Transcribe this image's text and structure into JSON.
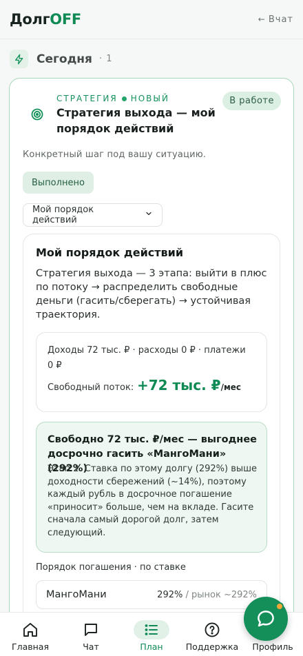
{
  "header": {
    "logo_part1": "Долг",
    "logo_part2": "OFF",
    "back_label": "Вчат",
    "back_arrow": "←"
  },
  "section": {
    "title": "Сегодня",
    "count": "· 1",
    "icon": "lightning-icon"
  },
  "task_card": {
    "kicker": "СТРАТЕГИЯ",
    "kicker_badge": "НОВЫЙ",
    "title": "Стратегия выхода — мой порядок действий",
    "status": "В работе",
    "description": "Конкретный шаг под вашу ситуацию.",
    "done_button": "Выполнено",
    "dropdown_label": "Мой порядок действий",
    "icon": "target-icon"
  },
  "plan": {
    "title": "Мой порядок действий",
    "lead": "Стратегия выхода — 3 этапа: выйти в плюс по потоку → распределить свободные деньги (гасить/сберегать) → устойчивая траектория.",
    "flow_summary": "Доходы 72 тыс. ₽ · расходы 0 ₽ · платежи 0 ₽",
    "free_flow_label": "Свободный поток:",
    "free_flow_value": "+72 тыс. ₽",
    "free_flow_unit": "/мес",
    "advice_title": "Свободно 72 тыс. ₽/мес — выгоднее досрочно гасить «МангоМани» (292%)",
    "advice_text": "Этап 2. Ставка по этому долгу (292%) выше доходности сбережений (~14%), поэтому каждый рубль в досрочное погашение «приносит» больше, чем на вкладе. Гасите сначала самый дорогой долг, затем следующий.",
    "order_title": "Порядок погашения · по ставке",
    "order_rows": [
      {
        "name": "МангоМани",
        "rate": "292%",
        "market": " / рынок ~292%"
      }
    ]
  },
  "bottom_nav": [
    {
      "label": "Главная",
      "icon": "home-icon"
    },
    {
      "label": "Чат",
      "icon": "chat-icon"
    },
    {
      "label": "План",
      "icon": "list-icon",
      "active": true
    },
    {
      "label": "Поддержка",
      "icon": "help-icon"
    },
    {
      "label": "Профиль",
      "icon": "profile-icon"
    }
  ],
  "colors": {
    "brand": "#0f8a55",
    "accent_bg": "#e2f1e8",
    "card_border": "#a9d9bd",
    "fab": "#148f5a",
    "notification": "#f2a736"
  }
}
